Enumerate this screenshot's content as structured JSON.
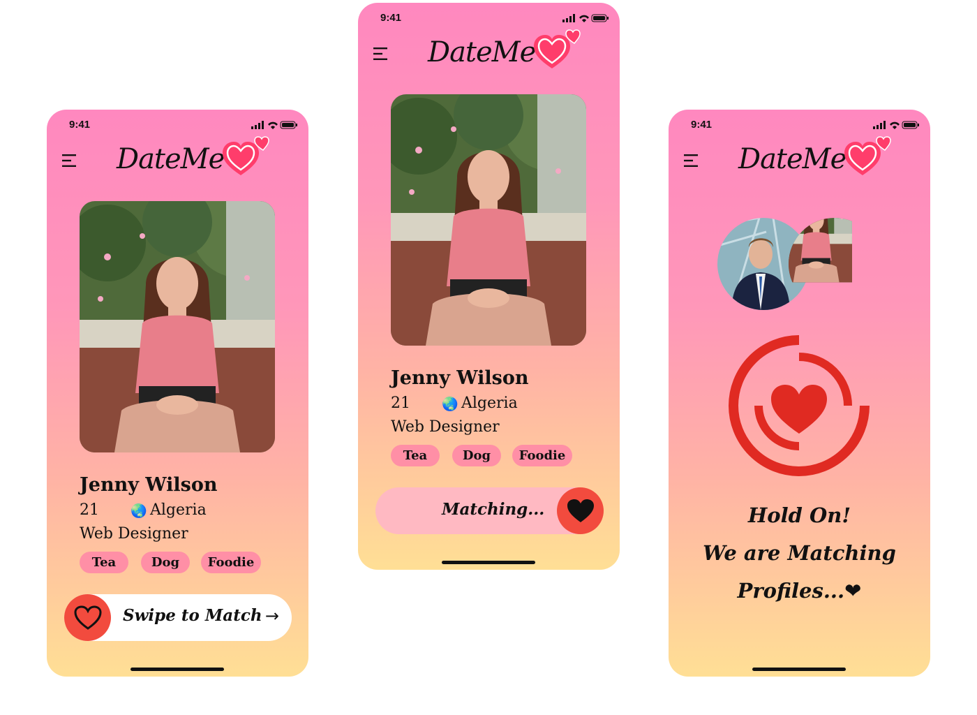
{
  "status": {
    "time": "9:41"
  },
  "brand": {
    "name": "DateMe",
    "accent": "#f24b3e",
    "heart_color": "#ff3d6b"
  },
  "profile": {
    "name": "Jenny Wilson",
    "age": "21",
    "country": "Algeria",
    "job": "Web Designer",
    "tags": [
      "Tea",
      "Dog",
      "Foodie"
    ]
  },
  "screen1": {
    "swipe_label": "Swipe to Match",
    "arrow": "→"
  },
  "screen2": {
    "matching_label": "Matching..."
  },
  "screen3": {
    "line1": "Hold On!",
    "line2": "We are Matching",
    "line3": "Profiles...",
    "line3_heart": "❤"
  },
  "icons": {
    "menu": "menu-icon",
    "globe": "🌏"
  }
}
